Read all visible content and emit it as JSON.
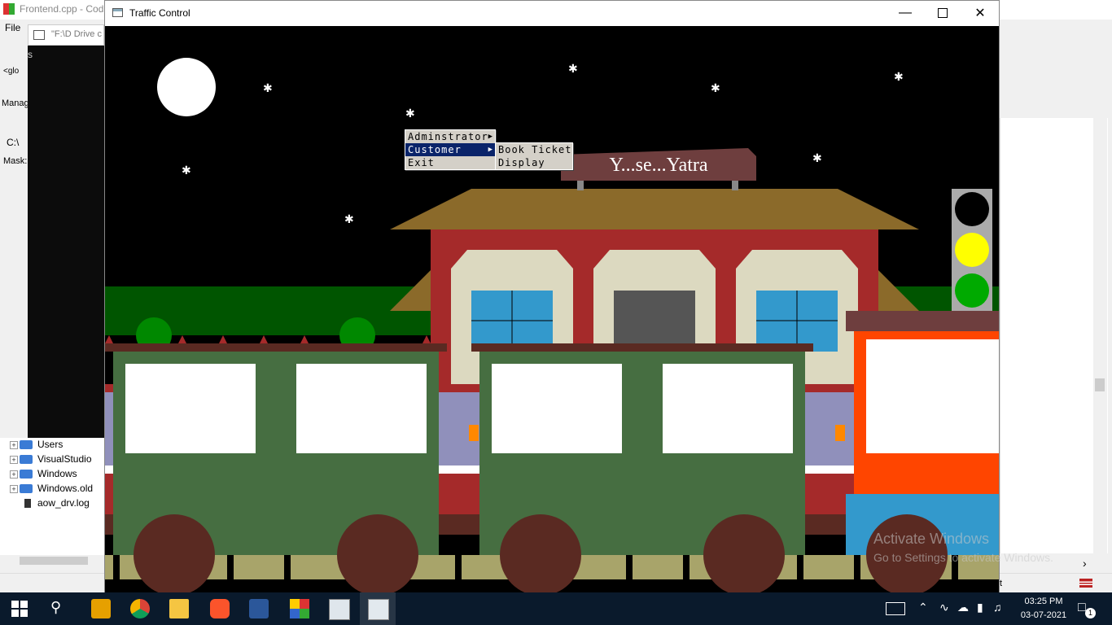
{
  "background_app": {
    "title": "Frontend.cpp - Cod",
    "menu_file": "File",
    "console_title": "\"F:\\D Drive c",
    "panel_labels": {
      "manage": "Manag",
      "path": "C:\\",
      "mask": "Mask:",
      "glob": "<glo",
      "console_char": "s"
    },
    "tree_items": [
      {
        "label": "Users",
        "expand": "+"
      },
      {
        "label": "VisualStudio",
        "expand": "+"
      },
      {
        "label": "Windows",
        "expand": "+"
      },
      {
        "label": "Windows.old",
        "expand": "+"
      }
    ],
    "file_item": "aow_drv.log",
    "right_status_char": "t"
  },
  "window": {
    "title": "Traffic Control",
    "minimize_icon": "minimize-icon",
    "maximize_icon": "maximize-icon",
    "close_icon": "close-icon"
  },
  "scene": {
    "station_sign": "Y...se...Yatra",
    "traffic_light": [
      "#000000",
      "#ffff00",
      "#00aa00"
    ],
    "colors": {
      "sky": "#000000",
      "moon": "#ffffff",
      "grass": "#005500",
      "roof": "#8b6a2a",
      "station_wall": "#a52a2a",
      "coach": "#466e41",
      "engine": "#ff4500",
      "wheel": "#5a2a22",
      "track": "#a8a46a"
    }
  },
  "menu": {
    "items": [
      {
        "label": "Adminstrator",
        "has_submenu": true,
        "selected": false
      },
      {
        "label": "Customer",
        "has_submenu": true,
        "selected": true
      },
      {
        "label": "Exit",
        "has_submenu": false,
        "selected": false
      }
    ],
    "submenu": [
      {
        "label": "Book Ticket"
      },
      {
        "label": "Display"
      }
    ]
  },
  "watermark": {
    "line1": "Activate Windows",
    "line2": "Go to Settings to activate Windows."
  },
  "taskbar": {
    "time": "03:25 PM",
    "date": "03-07-2021",
    "notification_count": "1"
  }
}
